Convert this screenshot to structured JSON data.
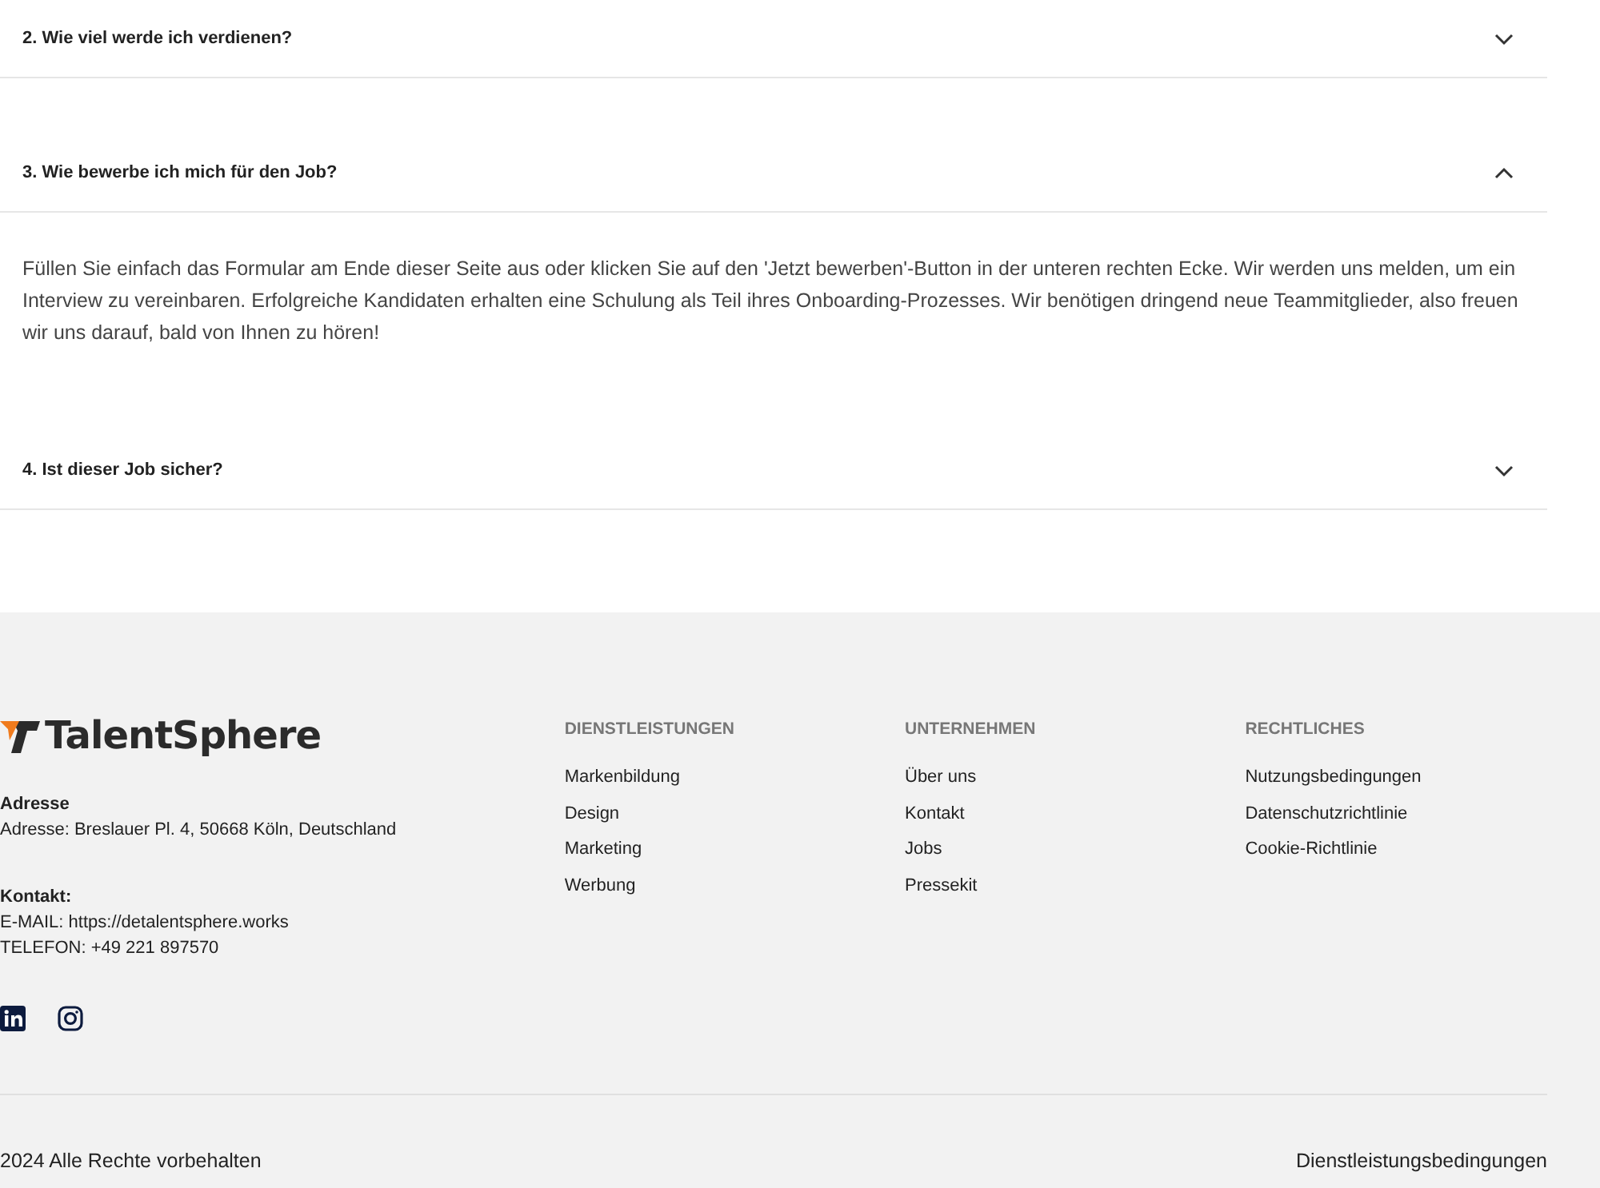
{
  "faq": [
    {
      "question": "2. Wie viel werde ich verdienen?",
      "expanded": false
    },
    {
      "question": "3. Wie bewerbe ich mich für den Job?",
      "expanded": true,
      "answer": "Füllen Sie einfach das Formular am Ende dieser Seite aus oder klicken Sie auf den 'Jetzt bewerben'-Button in der unteren rechten Ecke. Wir werden uns melden, um ein Interview zu vereinbaren. Erfolgreiche Kandidaten erhalten eine Schulung als Teil ihres Onboarding-Prozesses. Wir benötigen dringend neue Teammitglieder, also freuen wir uns darauf, bald von Ihnen zu hören!"
    },
    {
      "question": "4. Ist dieser Job sicher?",
      "expanded": false
    }
  ],
  "footer": {
    "logo": "TalentSphere",
    "address": {
      "heading": "Adresse",
      "lines": [
        "Adresse: Breslauer Pl. 4, 50668 Köln, Deutschland"
      ]
    },
    "contact": {
      "heading": "Kontakt:",
      "lines": [
        "E-MAIL: https://detalentsphere.works",
        "TELEFON: +49 221 897570"
      ]
    },
    "social": [
      {
        "kind": "linkedin"
      },
      {
        "kind": "instagram"
      }
    ],
    "columns": [
      {
        "heading": "DIENSTLEISTUNGEN",
        "links": [
          "Markenbildung",
          "Design",
          "Marketing",
          "Werbung"
        ]
      },
      {
        "heading": "UNTERNEHMEN",
        "links": [
          "Über uns",
          "Kontakt",
          "Jobs",
          "Pressekit"
        ]
      },
      {
        "heading": "RECHTLICHES",
        "links": [
          "Nutzungsbedingungen",
          "Datenschutzrichtlinie",
          "Cookie-Richtlinie"
        ]
      }
    ],
    "copyright": "2024 Alle Rechte vorbehalten",
    "terms_link": "Dienstleistungsbedingungen"
  }
}
